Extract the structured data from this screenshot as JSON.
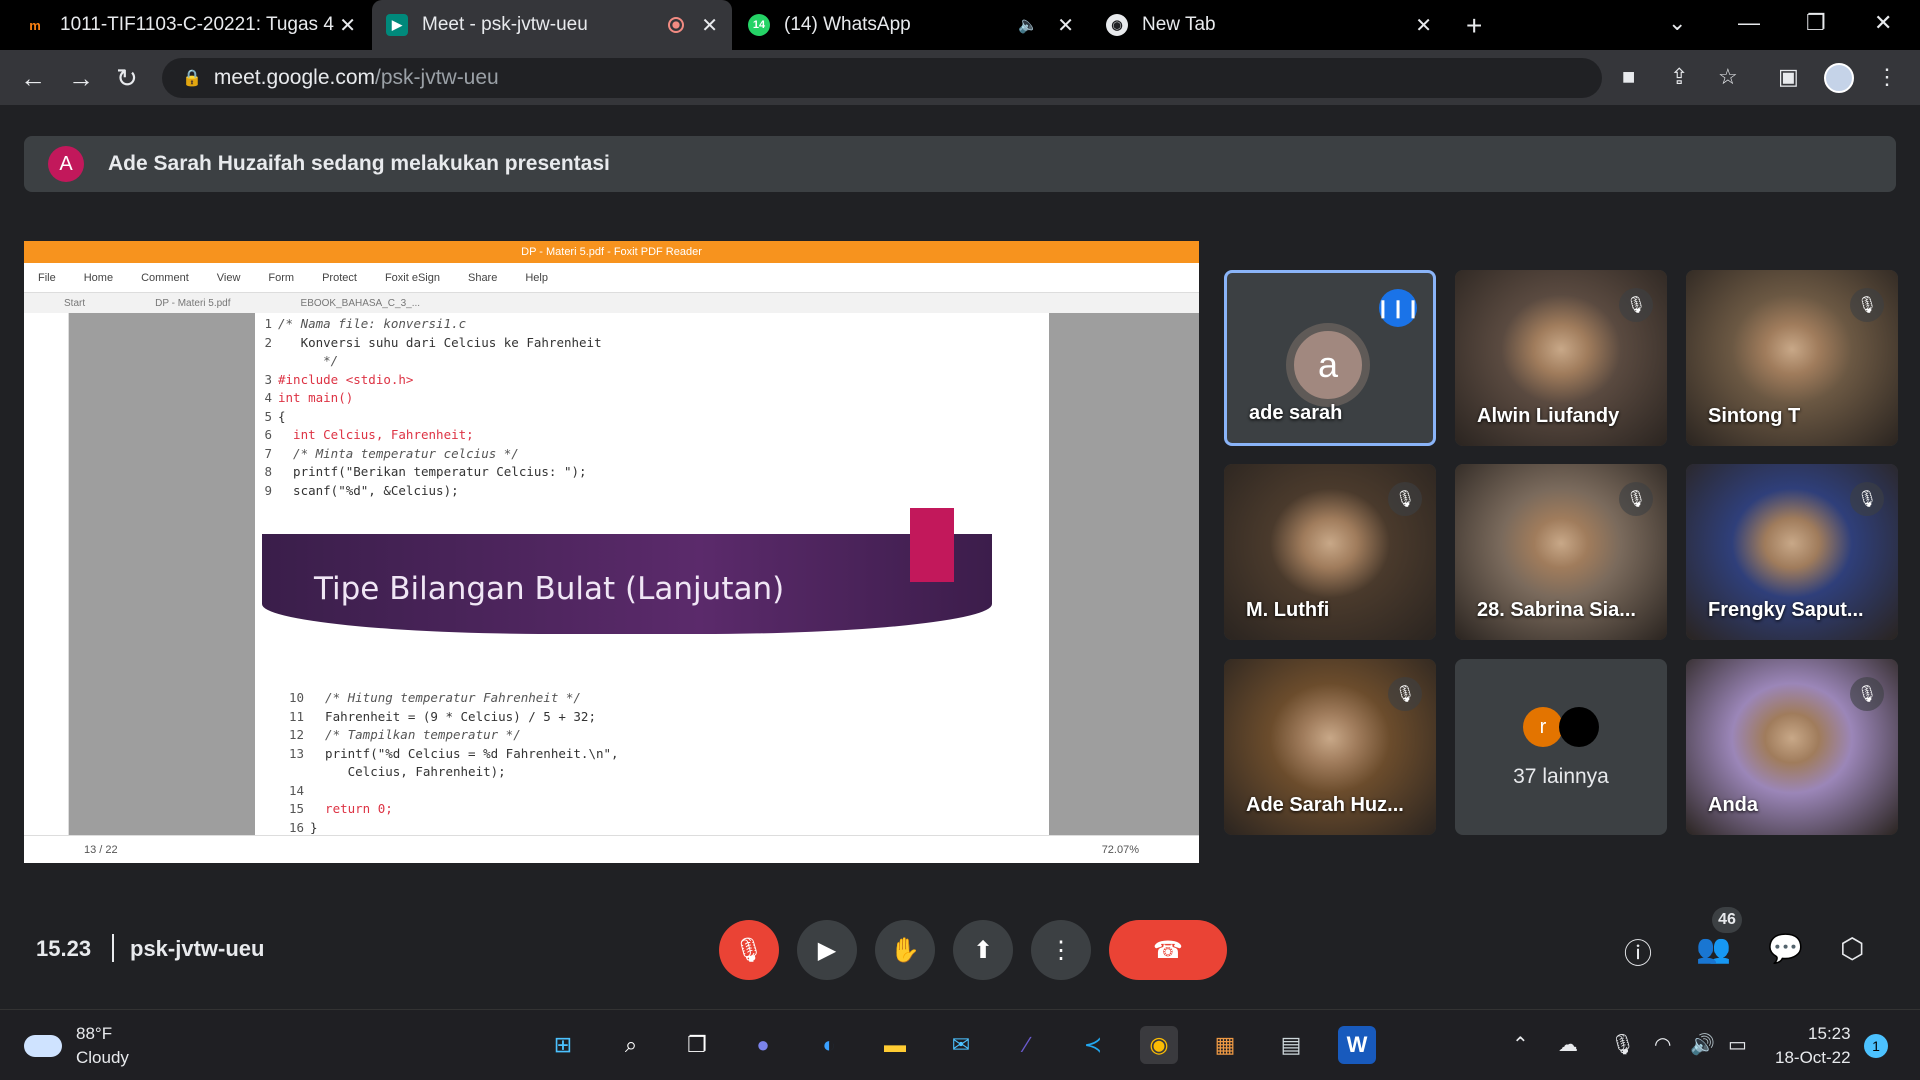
{
  "browser": {
    "tabs": [
      {
        "title": "1011-TIF1103-C-20221: Tugas 4",
        "favicon": "moodle-icon",
        "active": false
      },
      {
        "title": "Meet - psk-jvtw-ueu",
        "favicon": "meet-icon",
        "active": true
      },
      {
        "title": "(14) WhatsApp",
        "favicon": "whatsapp-icon",
        "badge": "14",
        "active": false
      },
      {
        "title": "New Tab",
        "favicon": "chrome-icon",
        "active": false
      }
    ],
    "url_host": "meet.google.com",
    "url_path": "/psk-jvtw-ueu"
  },
  "banner": {
    "avatar_letter": "A",
    "text": "Ade Sarah Huzaifah sedang melakukan presentasi"
  },
  "presentation": {
    "pdf_window_title": "DP - Materi 5.pdf - Foxit PDF Reader",
    "menu": [
      "File",
      "Home",
      "Comment",
      "View",
      "Form",
      "Protect",
      "Foxit eSign",
      "Share",
      "Help"
    ],
    "doc_tabs": [
      "Start",
      "DP - Materi 5.pdf",
      "EBOOK_BAHASA_C_3_..."
    ],
    "code_top": [
      {
        "n": "1",
        "t": "/* Nama file: konversi1.c"
      },
      {
        "n": "2",
        "t": "   Konversi suhu dari Celcius ke Fahrenheit"
      },
      {
        "n": "",
        "t": "      */"
      },
      {
        "n": "3",
        "t": "#include <stdio.h>"
      },
      {
        "n": "4",
        "t": "int main()"
      },
      {
        "n": "5",
        "t": "{"
      },
      {
        "n": "6",
        "t": "  int Celcius, Fahrenheit;"
      },
      {
        "n": "7",
        "t": "  /* Minta temperatur celcius */"
      },
      {
        "n": "8",
        "t": "  printf(\"Berikan temperatur Celcius: \");"
      },
      {
        "n": "9",
        "t": "  scanf(\"%d\", &Celcius);"
      }
    ],
    "slide_title": "Tipe Bilangan Bulat (Lanjutan)",
    "code_bottom": [
      {
        "n": "10",
        "t": "  /* Hitung temperatur Fahrenheit */"
      },
      {
        "n": "11",
        "t": "  Fahrenheit = (9 * Celcius) / 5 + 32;"
      },
      {
        "n": "12",
        "t": "  /* Tampilkan temperatur */"
      },
      {
        "n": "13",
        "t": "  printf(\"%d Celcius = %d Fahrenheit.\\n\","
      },
      {
        "n": "",
        "t": "     Celcius, Fahrenheit);"
      },
      {
        "n": "14",
        "t": ""
      },
      {
        "n": "15",
        "t": "  return 0;"
      },
      {
        "n": "16",
        "t": "}"
      }
    ],
    "page_indicator": "13 / 22",
    "zoom": "72.07%"
  },
  "participants": [
    {
      "name": "ade sarah",
      "avatar_letter": "a",
      "speaking": true,
      "muted": false,
      "camera": false
    },
    {
      "name": "Alwin Liufandy",
      "muted": true,
      "camera": true,
      "tone": "#5a4a40"
    },
    {
      "name": "Sintong T",
      "muted": true,
      "camera": true,
      "tone": "#6b5843"
    },
    {
      "name": "M. Luthfi",
      "muted": true,
      "camera": true,
      "tone": "#4a3a2c"
    },
    {
      "name": "28. Sabrina Sia...",
      "muted": true,
      "camera": true,
      "tone": "#7a6a5c"
    },
    {
      "name": "Frengky Saput...",
      "muted": true,
      "camera": true,
      "tone": "#2f3f7a"
    },
    {
      "name": "Ade Sarah Huz...",
      "muted": true,
      "camera": true,
      "tone": "#6b4c2c"
    },
    {
      "name": "37 lainnya",
      "others": true
    },
    {
      "name": "Anda",
      "muted": true,
      "camera": true,
      "tone": "#9b86b8"
    }
  ],
  "others_avatar_letter": "r",
  "meeting": {
    "time": "15.23",
    "code": "psk-jvtw-ueu",
    "participant_count": "46"
  },
  "taskbar": {
    "temperature": "88°F",
    "condition": "Cloudy",
    "clock_time": "15:23",
    "clock_date": "18-Oct-22",
    "notification_count": "1"
  },
  "colors": {
    "meet_bg": "#202124",
    "end_call_red": "#ea4335",
    "speaking_border": "#8ab4f8",
    "foxit_orange": "#f7931e"
  }
}
